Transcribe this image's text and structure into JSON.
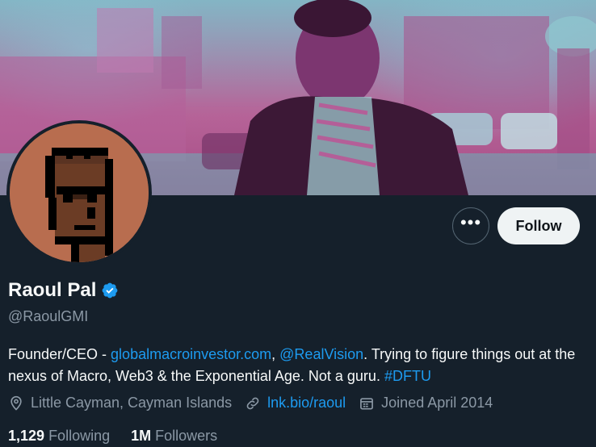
{
  "profile": {
    "name": "Raoul Pal",
    "handle": "@RaoulGMI",
    "bio": {
      "t1": "Founder/CEO - ",
      "link1": "globalmacroinvestor.com",
      "t2": ", ",
      "link2": "@RealVision",
      "t3": ". Trying to figure things out at the nexus of Macro, Web3 & the Exponential Age. Not a guru. ",
      "link3": "#DFTU"
    },
    "location": "Little Cayman, Cayman Islands",
    "website": "lnk.bio/raoul",
    "joined": "Joined April 2014",
    "following_count": "1,129",
    "following_label": "Following",
    "followers_count": "1M",
    "followers_label": "Followers"
  },
  "actions": {
    "more_label": "•••",
    "follow_label": "Follow"
  },
  "colors": {
    "background": "#15202b",
    "accent": "#1d9bf0",
    "muted": "#8b98a5",
    "text": "#f7f9f9"
  },
  "icons": {
    "verified": "verified-badge-icon",
    "location": "location-pin-icon",
    "link": "link-icon",
    "calendar": "calendar-icon",
    "more": "more-icon"
  }
}
